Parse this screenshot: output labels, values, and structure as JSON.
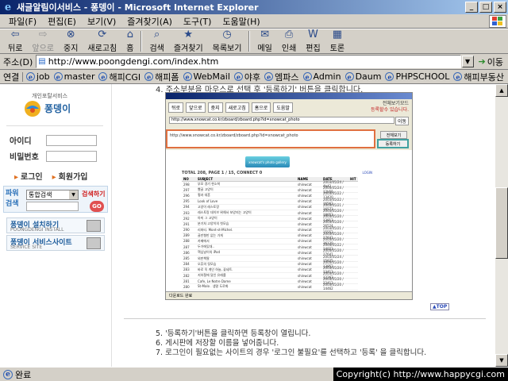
{
  "window": {
    "title": "새글알림이서비스 - 퐁뎅이 - Microsoft Internet Explorer",
    "controls": [
      "_",
      "□",
      "×"
    ]
  },
  "menu": [
    "파일(F)",
    "편집(E)",
    "보기(V)",
    "즐겨찾기(A)",
    "도구(T)",
    "도움말(H)"
  ],
  "toolbar": {
    "back": "뒤로",
    "forward": "앞으로",
    "stop": "중지",
    "refresh": "새로고침",
    "home": "홈",
    "search": "검색",
    "favorites": "즐겨찾기",
    "history": "목록보기",
    "mail": "메일",
    "print": "인쇄",
    "edit": "편집",
    "discuss": "토론"
  },
  "address": {
    "label": "주소(D)",
    "url": "http://www.poongdengi.com/index.htm",
    "go": "이동"
  },
  "links": {
    "label": "연결",
    "items": [
      "job",
      "master",
      "해피CGI",
      "해피폼",
      "WebMail",
      "야후",
      "엠파스",
      "Admin",
      "Daum",
      "PHPSCHOOL",
      "해피부동산"
    ]
  },
  "left": {
    "logo_small": "개인포탈서비스",
    "logo_text": "퐁뎅이",
    "id_label": "아이디",
    "pw_label": "비밀번호",
    "login": "로그인",
    "join": "회원가입",
    "power_label": "파워검색",
    "power_select": "통합검색",
    "power_help": "검색하기",
    "go": "GO",
    "banner1_main": "퐁뎅이 설치하기",
    "banner1_sub": "POONGDENGI INSTALL",
    "banner2_main": "퐁뎅이 서비스사이트",
    "banner2_sub": "SERVICE SITE"
  },
  "main": {
    "top_cut": "4. 주소부분을 마우스로 선택 후 '등록하기' 버튼을 클릭합니다.",
    "top_link": "TOP",
    "instructions": [
      "5. '등록하기'버튼을 클릭하면 등록창이 열립니다.",
      "6. 게시판에 저장할 이름을 넣어줍니다.",
      "7. 로그인이 필요없는 사이트의 경우 '로그인 불필요'를 선택하고 '등록' 을 클릭합니다."
    ]
  },
  "screenshot": {
    "toolbar": [
      "뒤로",
      "앞으로",
      "중지",
      "새로고침",
      "홈으로",
      "도움말"
    ],
    "corner_line1": "전체보기모드",
    "corner_line2": "등록할수 있습니다.",
    "address": "http://www.xnowcat.co.kr/zboard/zboard.php?id=xnowcat_photo",
    "move": "이동",
    "selected_url": "http://www.xnowcat.co.kr/zboard/zboard.php?id=xnowcat_photo",
    "btn1": "전체보기",
    "btn2": "등록하기",
    "banner": "xnowcat's photo gallery",
    "total": "TOTAL 208, PAGE 1 / 15, CONNECT 0",
    "login": "LOGIN",
    "columns": [
      "NO",
      "SUBJECT",
      "NAME",
      "DATE",
      "HIT"
    ],
    "rows": [
      {
        "no": "298",
        "subj": "부모 경기 현소착",
        "name": "shinwcat",
        "date": "2003/05/24 / 4b42",
        "hit": ""
      },
      {
        "no": "297",
        "subj": "빨골 고양이",
        "name": "shinwcat",
        "date": "2003/05/24 / 12b56",
        "hit": ""
      },
      {
        "no": "296",
        "subj": "횡과 대혼",
        "name": "shinwcat",
        "date": "2003/05/22 / 13420",
        "hit": ""
      },
      {
        "no": "295",
        "subj": "Look of Love",
        "name": "shinwcat",
        "date": "2003/05/22 / 16562",
        "hit": ""
      },
      {
        "no": "294",
        "subj": "고양이 레스토랑",
        "name": "shinwcat",
        "date": "2003/05/21 / 16573",
        "hit": ""
      },
      {
        "no": "293",
        "subj": "레스토랑 데이브 위해서 보양지는 고양이",
        "name": "shinwcat",
        "date": "2003/05/20 / 18653",
        "hit": ""
      },
      {
        "no": "292",
        "subj": "아끼 그 고양이",
        "name": "shinwcat",
        "date": "2003/05/20 / 13813",
        "hit": ""
      },
      {
        "no": "291",
        "subj": "분기처 고양이의 첫모습",
        "name": "shinwcat",
        "date": "2003/05/20 / 26524",
        "hit": ""
      },
      {
        "no": "290",
        "subj": "리파티. Mont-st-Michel.",
        "name": "shinwcat",
        "date": "2003/05/21 / 15552",
        "hit": ""
      },
      {
        "no": "289",
        "subj": "골만형만 없는 가게",
        "name": "shinwcat",
        "date": "2003/05/20 / 27631",
        "hit": ""
      },
      {
        "no": "288",
        "subj": "카페에서",
        "name": "shinwcat",
        "date": "2003/05/20 / 36120",
        "hit": ""
      },
      {
        "no": "287",
        "subj": "두가에있대..",
        "name": "shinwcat",
        "date": "2003/05/22 / 14023",
        "hit": ""
      },
      {
        "no": "286",
        "subj": "핵심날이의 iPod",
        "name": "shinwcat",
        "date": "2003/05/20 / 27641",
        "hit": ""
      },
      {
        "no": "285",
        "subj": "외판책딸",
        "name": "shinwcat",
        "date": "2003/05/24 / 15625",
        "hit": ""
      },
      {
        "no": "284",
        "subj": "오휴의 뒷모습",
        "name": "shinwcat",
        "date": "2003/05/20 / 13852",
        "hit": ""
      },
      {
        "no": "283",
        "subj": "바로 옥 계인 하늘, 꽃네트.",
        "name": "shinwcat",
        "date": "2003/05/20 / 13413",
        "hit": ""
      },
      {
        "no": "282",
        "subj": "지하철에 달인 유래를",
        "name": "shinwcat",
        "date": "2003/05/20 / 12263",
        "hit": ""
      },
      {
        "no": "281",
        "subj": "Cafe, Le Notre Dame",
        "name": "shinwcat",
        "date": "2003/05/20 / 22412",
        "hit": ""
      },
      {
        "no": "280",
        "subj": "St-Malo . 생말 도로화",
        "name": "shinwcat",
        "date": "2003/05/20 / 14462",
        "hit": ""
      }
    ],
    "status": "다운로드 완료"
  },
  "status": {
    "text": "완료",
    "copyright": "Copyright(c) http://www.happycgi.com"
  }
}
